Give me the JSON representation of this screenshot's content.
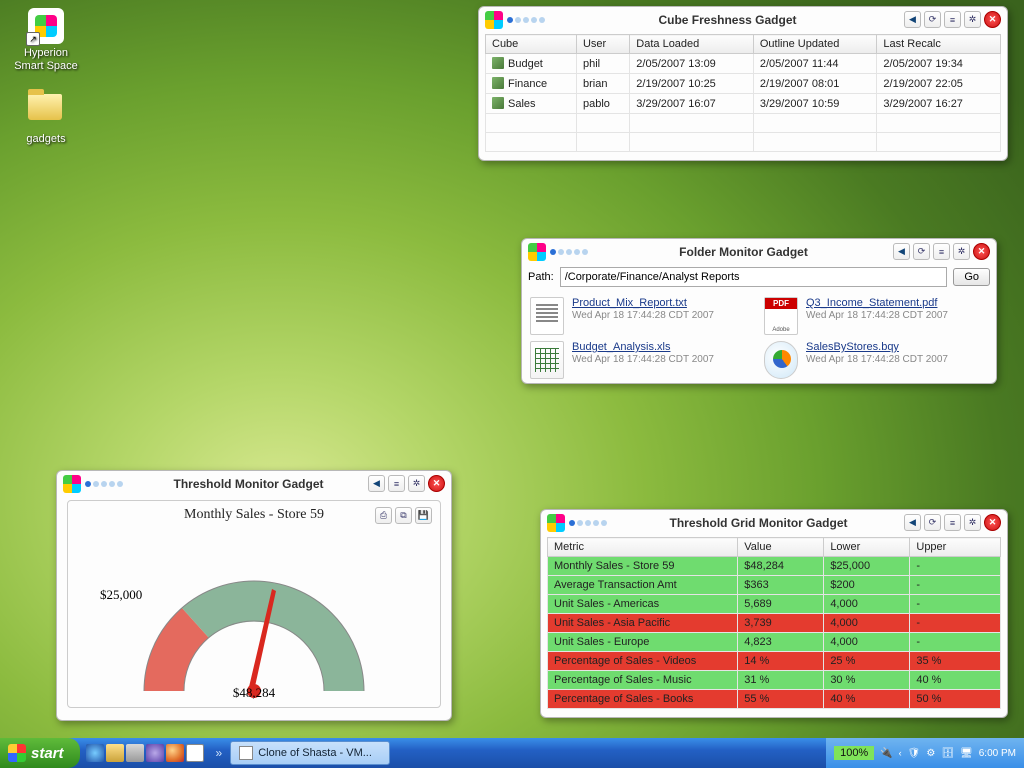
{
  "desktop": {
    "icons": [
      {
        "name": "Hyperion\nSmart Space"
      },
      {
        "name": "gadgets"
      }
    ]
  },
  "cube_gadget": {
    "title": "Cube Freshness Gadget",
    "columns": [
      "Cube",
      "User",
      "Data Loaded",
      "Outline Updated",
      "Last Recalc"
    ],
    "rows": [
      {
        "cube": "Budget",
        "user": "phil",
        "loaded": "2/05/2007 13:09",
        "outline": "2/05/2007 11:44",
        "recalc": "2/05/2007 19:34"
      },
      {
        "cube": "Finance",
        "user": "brian",
        "loaded": "2/19/2007 10:25",
        "outline": "2/19/2007 08:01",
        "recalc": "2/19/2007 22:05"
      },
      {
        "cube": "Sales",
        "user": "pablo",
        "loaded": "3/29/2007 16:07",
        "outline": "3/29/2007 10:59",
        "recalc": "3/29/2007 16:27"
      }
    ]
  },
  "folder_gadget": {
    "title": "Folder Monitor Gadget",
    "path_label": "Path:",
    "path_value": "/Corporate/Finance/Analyst Reports",
    "go_label": "Go",
    "files": [
      {
        "name": "Product_Mix_Report.txt",
        "ts": "Wed Apr 18 17:44:28 CDT 2007",
        "type": "txt"
      },
      {
        "name": "Q3_Income_Statement.pdf",
        "ts": "Wed Apr 18 17:44:28 CDT 2007",
        "type": "pdf"
      },
      {
        "name": "Budget_Analysis.xls",
        "ts": "Wed Apr 18 17:44:28 CDT 2007",
        "type": "xls"
      },
      {
        "name": "SalesByStores.bqy",
        "ts": "Wed Apr 18 17:44:28 CDT 2007",
        "type": "bqy"
      }
    ]
  },
  "threshold_gadget": {
    "title": "Threshold Monitor Gadget",
    "gauge_title": "Monthly Sales - Store 59",
    "threshold_label": "$25,000",
    "value_label": "$48,284"
  },
  "threshold_grid_gadget": {
    "title": "Threshold Grid Monitor Gadget",
    "columns": [
      "Metric",
      "Value",
      "Lower",
      "Upper"
    ],
    "rows": [
      {
        "metric": "Monthly Sales - Store 59",
        "value": "$48,284",
        "lower": "$25,000",
        "upper": "-",
        "status": "green"
      },
      {
        "metric": "Average Transaction Amt",
        "value": "$363",
        "lower": "$200",
        "upper": "-",
        "status": "green"
      },
      {
        "metric": "Unit Sales - Americas",
        "value": "5,689",
        "lower": "4,000",
        "upper": "-",
        "status": "green"
      },
      {
        "metric": "Unit Sales - Asia Pacific",
        "value": "3,739",
        "lower": "4,000",
        "upper": "-",
        "status": "red"
      },
      {
        "metric": "Unit Sales - Europe",
        "value": "4,823",
        "lower": "4,000",
        "upper": "-",
        "status": "green"
      },
      {
        "metric": "Percentage of Sales - Videos",
        "value": "14 %",
        "lower": "25 %",
        "upper": "35 %",
        "status": "red"
      },
      {
        "metric": "Percentage of Sales - Music",
        "value": "31 %",
        "lower": "30 %",
        "upper": "40 %",
        "status": "green"
      },
      {
        "metric": "Percentage of Sales - Books",
        "value": "55 %",
        "lower": "40 %",
        "upper": "50 %",
        "status": "red"
      }
    ]
  },
  "taskbar": {
    "start": "start",
    "task": "Clone of Shasta - VM...",
    "battery": "100%",
    "clock": "6:00 PM"
  },
  "chart_data": {
    "type": "gauge",
    "title": "Monthly Sales - Store 59",
    "value": 48284,
    "threshold_lower": 25000,
    "range": [
      0,
      60000
    ],
    "value_label": "$48,284",
    "threshold_label": "$25,000",
    "zones": [
      {
        "from": 0,
        "to": 25000,
        "color": "#e46a5e",
        "meaning": "below-threshold"
      },
      {
        "from": 25000,
        "to": 60000,
        "color": "#8bb59a",
        "meaning": "above-threshold"
      }
    ]
  }
}
